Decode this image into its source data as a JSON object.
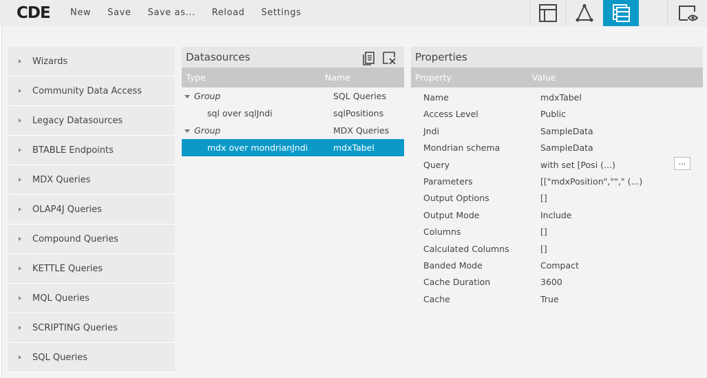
{
  "app": {
    "logo": "CDE"
  },
  "menu": {
    "items": [
      "New",
      "Save",
      "Save as...",
      "Reload",
      "Settings"
    ]
  },
  "modes": [
    {
      "icon": "layout-icon",
      "active": false
    },
    {
      "icon": "components-icon",
      "active": false
    },
    {
      "icon": "datasources-icon",
      "active": true
    },
    {
      "icon": "preview-icon",
      "active": false
    }
  ],
  "palette": {
    "items": [
      "Wizards",
      "Community Data Access",
      "Legacy Datasources",
      "BTABLE Endpoints",
      "MDX Queries",
      "OLAP4J Queries",
      "Compound Queries",
      "KETTLE Queries",
      "MQL Queries",
      "SCRIPTING Queries",
      "SQL Queries"
    ]
  },
  "datasources": {
    "title": "Datasources",
    "columns": {
      "type": "Type",
      "name": "Name"
    },
    "rows": [
      {
        "kind": "group",
        "type": "Group",
        "name": "SQL Queries"
      },
      {
        "kind": "item",
        "type": "sql over sqlJndi",
        "name": "sqlPositions"
      },
      {
        "kind": "group",
        "type": "Group",
        "name": "MDX Queries"
      },
      {
        "kind": "item",
        "type": "mdx over mondrianJndi",
        "name": "mdxTabel",
        "selected": true
      }
    ]
  },
  "properties": {
    "title": "Properties",
    "columns": {
      "property": "Property",
      "value": "Value"
    },
    "rows": [
      {
        "property": "Name",
        "value": "mdxTabel"
      },
      {
        "property": "Access Level",
        "value": "Public"
      },
      {
        "property": "Jndi",
        "value": "SampleData"
      },
      {
        "property": "Mondrian schema",
        "value": "SampleData"
      },
      {
        "property": "Query",
        "value": "with set [Posi (...)",
        "button": "..."
      },
      {
        "property": "Parameters",
        "value": "[[\"mdxPosition\",\"\",\" (...)"
      },
      {
        "property": "Output Options",
        "value": "[]"
      },
      {
        "property": "Output Mode",
        "value": "Include"
      },
      {
        "property": "Columns",
        "value": "[]"
      },
      {
        "property": "Calculated Columns",
        "value": "[]"
      },
      {
        "property": "Banded Mode",
        "value": "Compact"
      },
      {
        "property": "Cache Duration",
        "value": "3600"
      },
      {
        "property": "Cache",
        "value": "True"
      }
    ]
  },
  "colors": {
    "accent": "#0b99c8",
    "header_gray": "#c8c8c8"
  }
}
